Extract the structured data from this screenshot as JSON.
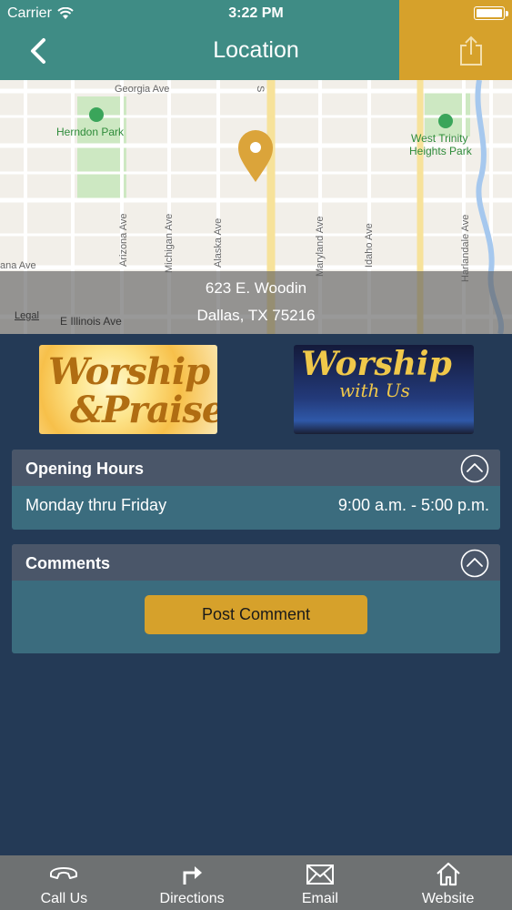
{
  "status": {
    "carrier": "Carrier",
    "time": "3:22 PM"
  },
  "nav": {
    "title": "Location",
    "back_icon": "chevron-left-icon",
    "share_icon": "share-icon"
  },
  "map": {
    "streets": {
      "georgia": "Georgia Ave",
      "illinois": "E Illinois Ave",
      "arizona": "Arizona Ave",
      "michigan": "Michigan Ave",
      "alaska": "Alaska Ave",
      "maryland": "Maryland Ave",
      "idaho": "Idaho Ave",
      "harlandale": "Harlandale Ave",
      "s": "S",
      "ana": "ana Ave"
    },
    "parks": {
      "herndon": "Herndon Park",
      "west_trinity_1": "West Trinity",
      "west_trinity_2": "Heights Park"
    },
    "legal": "Legal",
    "address_line1": "623 E. Woodin",
    "address_line2": "Dallas, TX 75216"
  },
  "banners": {
    "left": {
      "line1": "Worship",
      "line2": "&Praise"
    },
    "right": {
      "line1": "Worship",
      "line2": "with Us"
    }
  },
  "hours": {
    "title": "Opening Hours",
    "day": "Monday thru Friday",
    "time": "9:00 a.m. - 5:00 p.m."
  },
  "comments": {
    "title": "Comments",
    "post_label": "Post Comment"
  },
  "tabs": [
    {
      "label": "Call Us",
      "icon": "phone-icon"
    },
    {
      "label": "Directions",
      "icon": "directions-icon"
    },
    {
      "label": "Email",
      "icon": "envelope-icon"
    },
    {
      "label": "Website",
      "icon": "home-icon"
    }
  ],
  "colors": {
    "header": "#3f8c85",
    "accent": "#d6a12b",
    "background": "#243a56",
    "panel": "#3b6c7e",
    "panel_head": "#4a5669",
    "tabbar": "#6e7172"
  }
}
